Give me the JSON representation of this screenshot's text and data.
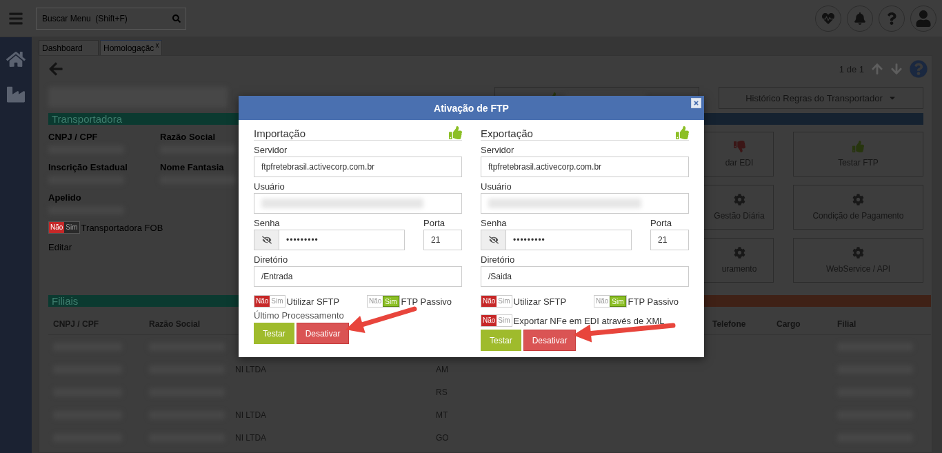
{
  "header": {
    "search": {
      "placeholder": "Buscar Menu  (Shift+F)"
    }
  },
  "tabs": [
    {
      "label": "Dashboard",
      "selected": false
    },
    {
      "label": "Homologaçãc",
      "selected": true,
      "close_label": "x"
    }
  ],
  "pager": "1 de 1",
  "company": {
    "section": "Transportadora",
    "fields": [
      {
        "label": "CNPJ / CPF"
      },
      {
        "label": "Razão Social"
      },
      {
        "label": "Inscrição Estadual"
      },
      {
        "label": "Nome Fantasia"
      },
      {
        "label": "Apelido"
      }
    ],
    "fob": {
      "label": "Transportadora FOB",
      "off_text": "Não",
      "on_text": "Sim",
      "on": false
    },
    "edit": "Editar"
  },
  "history_button": "Histórico Regras do Transportador",
  "actions": [
    {
      "label": "dar EDI",
      "kind": "thumbs-down"
    },
    {
      "label": "Testar FTP",
      "kind": "thumbs-up"
    },
    {
      "label": "Gestão Diária",
      "kind": "gear"
    },
    {
      "label": "Condição de Pagamento",
      "kind": "gear"
    },
    {
      "label": "uramento",
      "kind": "gear"
    },
    {
      "label": "WebService / API",
      "kind": "gear"
    }
  ],
  "branches": {
    "section": "Filiais",
    "columns": [
      "CNPJ / CPF",
      "Razão Social",
      "Telefone",
      "Cargo",
      "Filial"
    ],
    "rows": [
      {
        "name": "NI LTDA",
        "uf": "AM"
      },
      {
        "uf": "RS"
      },
      {
        "name": "NI LTDA",
        "uf": "MT"
      },
      {
        "name": "NI LTDA",
        "uf": "GO"
      }
    ]
  },
  "modal": {
    "title": "Ativação de FTP",
    "panels": [
      {
        "title": "Importação",
        "server_label": "Servidor",
        "server": "ftpfretebrasil.activecorp.com.br",
        "user_label": "Usuário",
        "password_label": "Senha",
        "password": "•••••••••",
        "port_label": "Porta",
        "port": "21",
        "dir_label": "Diretório",
        "dir": "/Entrada",
        "toggles": [
          {
            "label": "Utilizar SFTP",
            "off_text": "Não",
            "on_text": "Sim",
            "on": false
          },
          {
            "label": "FTP Passivo",
            "off_text": "Não",
            "on_text": "Sim",
            "on": true
          }
        ],
        "last_run": "Último Processamento",
        "buttons": [
          {
            "label": "Testar",
            "kind": "test"
          },
          {
            "label": "Desativar",
            "kind": "danger"
          }
        ]
      },
      {
        "title": "Exportação",
        "server_label": "Servidor",
        "server": "ftpfretebrasil.activecorp.com.br",
        "user_label": "Usuário",
        "password_label": "Senha",
        "password": "•••••••••",
        "port_label": "Porta",
        "port": "21",
        "dir_label": "Diretório",
        "dir": "/Saida",
        "toggles": [
          {
            "label": "Utilizar SFTP",
            "off_text": "Não",
            "on_text": "Sim",
            "on": false
          },
          {
            "label": "FTP Passivo",
            "off_text": "Não",
            "on_text": "Sim",
            "on": true
          },
          {
            "label": "Exportar NFe em EDI através de XML",
            "off_text": "Não",
            "on_text": "Sim",
            "on": false
          }
        ],
        "buttons": [
          {
            "label": "Testar",
            "kind": "test"
          },
          {
            "label": "Desativar",
            "kind": "danger"
          }
        ]
      }
    ]
  }
}
